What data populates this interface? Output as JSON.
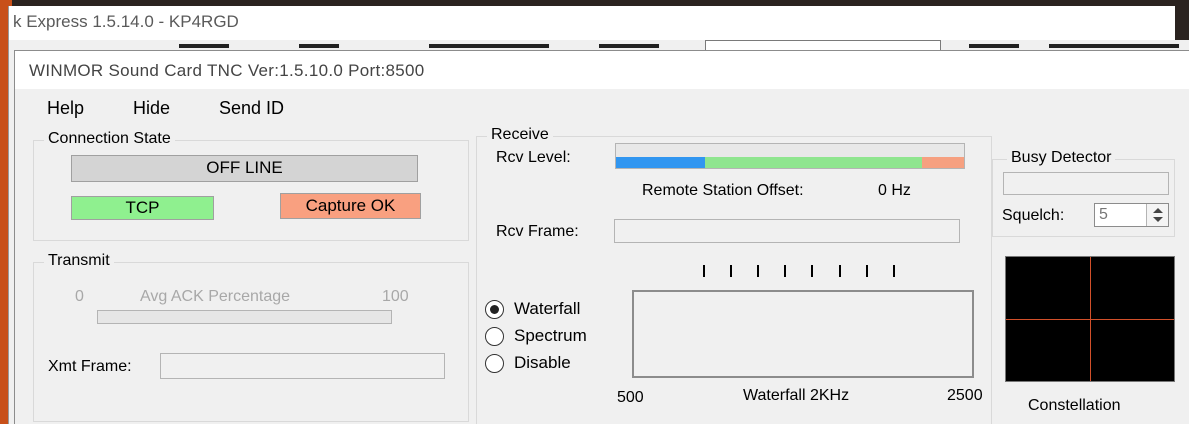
{
  "background_window": {
    "title": "k Express 1.5.14.0 - KP4RGD"
  },
  "dialog": {
    "title": "WINMOR Sound Card TNC Ver:1.5.10.0 Port:8500",
    "menu": {
      "help": "Help",
      "hide": "Hide",
      "send_id": "Send ID"
    }
  },
  "connection_state": {
    "label": "Connection State",
    "status": "OFF LINE",
    "tcp": "TCP",
    "capture": "Capture OK"
  },
  "transmit": {
    "label": "Transmit",
    "ack_min": "0",
    "ack_label": "Avg ACK Percentage",
    "ack_max": "100",
    "xmt_frame_label": "Xmt Frame:",
    "xmt_frame_value": ""
  },
  "receive": {
    "label": "Receive",
    "rcv_level_label": "Rcv Level:",
    "offset_label": "Remote Station Offset:",
    "offset_value": "0 Hz",
    "rcv_frame_label": "Rcv Frame:",
    "rcv_frame_value": ""
  },
  "display_mode": {
    "options": [
      "Waterfall",
      "Spectrum",
      "Disable"
    ],
    "selected": "Waterfall"
  },
  "waterfall": {
    "min": "500",
    "label": "Waterfall 2KHz",
    "max": "2500"
  },
  "busy_detector": {
    "label": "Busy Detector",
    "squelch_label": "Squelch:",
    "squelch_value": "5"
  },
  "constellation": {
    "label": "Constellation"
  },
  "colors": {
    "tcp_ok": "#8ff08f",
    "capture_ok": "#f9a080",
    "offline": "#d4d4d4",
    "level_blue": "#3196f0",
    "level_green": "#8fe58f",
    "level_orange": "#f6a080",
    "constellation_cross": "#d2502a"
  }
}
